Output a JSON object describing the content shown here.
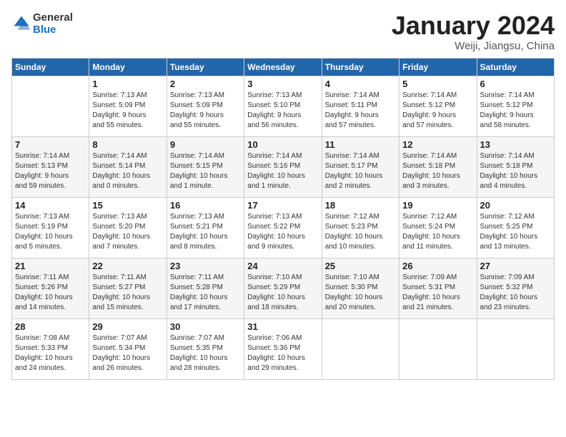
{
  "header": {
    "logo_general": "General",
    "logo_blue": "Blue",
    "month": "January 2024",
    "location": "Weiji, Jiangsu, China"
  },
  "days_of_week": [
    "Sunday",
    "Monday",
    "Tuesday",
    "Wednesday",
    "Thursday",
    "Friday",
    "Saturday"
  ],
  "weeks": [
    [
      {
        "day": "",
        "info": ""
      },
      {
        "day": "1",
        "info": "Sunrise: 7:13 AM\nSunset: 5:09 PM\nDaylight: 9 hours\nand 55 minutes."
      },
      {
        "day": "2",
        "info": "Sunrise: 7:13 AM\nSunset: 5:09 PM\nDaylight: 9 hours\nand 55 minutes."
      },
      {
        "day": "3",
        "info": "Sunrise: 7:13 AM\nSunset: 5:10 PM\nDaylight: 9 hours\nand 56 minutes."
      },
      {
        "day": "4",
        "info": "Sunrise: 7:14 AM\nSunset: 5:11 PM\nDaylight: 9 hours\nand 57 minutes."
      },
      {
        "day": "5",
        "info": "Sunrise: 7:14 AM\nSunset: 5:12 PM\nDaylight: 9 hours\nand 57 minutes."
      },
      {
        "day": "6",
        "info": "Sunrise: 7:14 AM\nSunset: 5:12 PM\nDaylight: 9 hours\nand 58 minutes."
      }
    ],
    [
      {
        "day": "7",
        "info": "Sunrise: 7:14 AM\nSunset: 5:13 PM\nDaylight: 9 hours\nand 59 minutes."
      },
      {
        "day": "8",
        "info": "Sunrise: 7:14 AM\nSunset: 5:14 PM\nDaylight: 10 hours\nand 0 minutes."
      },
      {
        "day": "9",
        "info": "Sunrise: 7:14 AM\nSunset: 5:15 PM\nDaylight: 10 hours\nand 1 minute."
      },
      {
        "day": "10",
        "info": "Sunrise: 7:14 AM\nSunset: 5:16 PM\nDaylight: 10 hours\nand 1 minute."
      },
      {
        "day": "11",
        "info": "Sunrise: 7:14 AM\nSunset: 5:17 PM\nDaylight: 10 hours\nand 2 minutes."
      },
      {
        "day": "12",
        "info": "Sunrise: 7:14 AM\nSunset: 5:18 PM\nDaylight: 10 hours\nand 3 minutes."
      },
      {
        "day": "13",
        "info": "Sunrise: 7:14 AM\nSunset: 5:18 PM\nDaylight: 10 hours\nand 4 minutes."
      }
    ],
    [
      {
        "day": "14",
        "info": "Sunrise: 7:13 AM\nSunset: 5:19 PM\nDaylight: 10 hours\nand 5 minutes."
      },
      {
        "day": "15",
        "info": "Sunrise: 7:13 AM\nSunset: 5:20 PM\nDaylight: 10 hours\nand 7 minutes."
      },
      {
        "day": "16",
        "info": "Sunrise: 7:13 AM\nSunset: 5:21 PM\nDaylight: 10 hours\nand 8 minutes."
      },
      {
        "day": "17",
        "info": "Sunrise: 7:13 AM\nSunset: 5:22 PM\nDaylight: 10 hours\nand 9 minutes."
      },
      {
        "day": "18",
        "info": "Sunrise: 7:12 AM\nSunset: 5:23 PM\nDaylight: 10 hours\nand 10 minutes."
      },
      {
        "day": "19",
        "info": "Sunrise: 7:12 AM\nSunset: 5:24 PM\nDaylight: 10 hours\nand 11 minutes."
      },
      {
        "day": "20",
        "info": "Sunrise: 7:12 AM\nSunset: 5:25 PM\nDaylight: 10 hours\nand 13 minutes."
      }
    ],
    [
      {
        "day": "21",
        "info": "Sunrise: 7:11 AM\nSunset: 5:26 PM\nDaylight: 10 hours\nand 14 minutes."
      },
      {
        "day": "22",
        "info": "Sunrise: 7:11 AM\nSunset: 5:27 PM\nDaylight: 10 hours\nand 15 minutes."
      },
      {
        "day": "23",
        "info": "Sunrise: 7:11 AM\nSunset: 5:28 PM\nDaylight: 10 hours\nand 17 minutes."
      },
      {
        "day": "24",
        "info": "Sunrise: 7:10 AM\nSunset: 5:29 PM\nDaylight: 10 hours\nand 18 minutes."
      },
      {
        "day": "25",
        "info": "Sunrise: 7:10 AM\nSunset: 5:30 PM\nDaylight: 10 hours\nand 20 minutes."
      },
      {
        "day": "26",
        "info": "Sunrise: 7:09 AM\nSunset: 5:31 PM\nDaylight: 10 hours\nand 21 minutes."
      },
      {
        "day": "27",
        "info": "Sunrise: 7:09 AM\nSunset: 5:32 PM\nDaylight: 10 hours\nand 23 minutes."
      }
    ],
    [
      {
        "day": "28",
        "info": "Sunrise: 7:08 AM\nSunset: 5:33 PM\nDaylight: 10 hours\nand 24 minutes."
      },
      {
        "day": "29",
        "info": "Sunrise: 7:07 AM\nSunset: 5:34 PM\nDaylight: 10 hours\nand 26 minutes."
      },
      {
        "day": "30",
        "info": "Sunrise: 7:07 AM\nSunset: 5:35 PM\nDaylight: 10 hours\nand 28 minutes."
      },
      {
        "day": "31",
        "info": "Sunrise: 7:06 AM\nSunset: 5:36 PM\nDaylight: 10 hours\nand 29 minutes."
      },
      {
        "day": "",
        "info": ""
      },
      {
        "day": "",
        "info": ""
      },
      {
        "day": "",
        "info": ""
      }
    ]
  ]
}
